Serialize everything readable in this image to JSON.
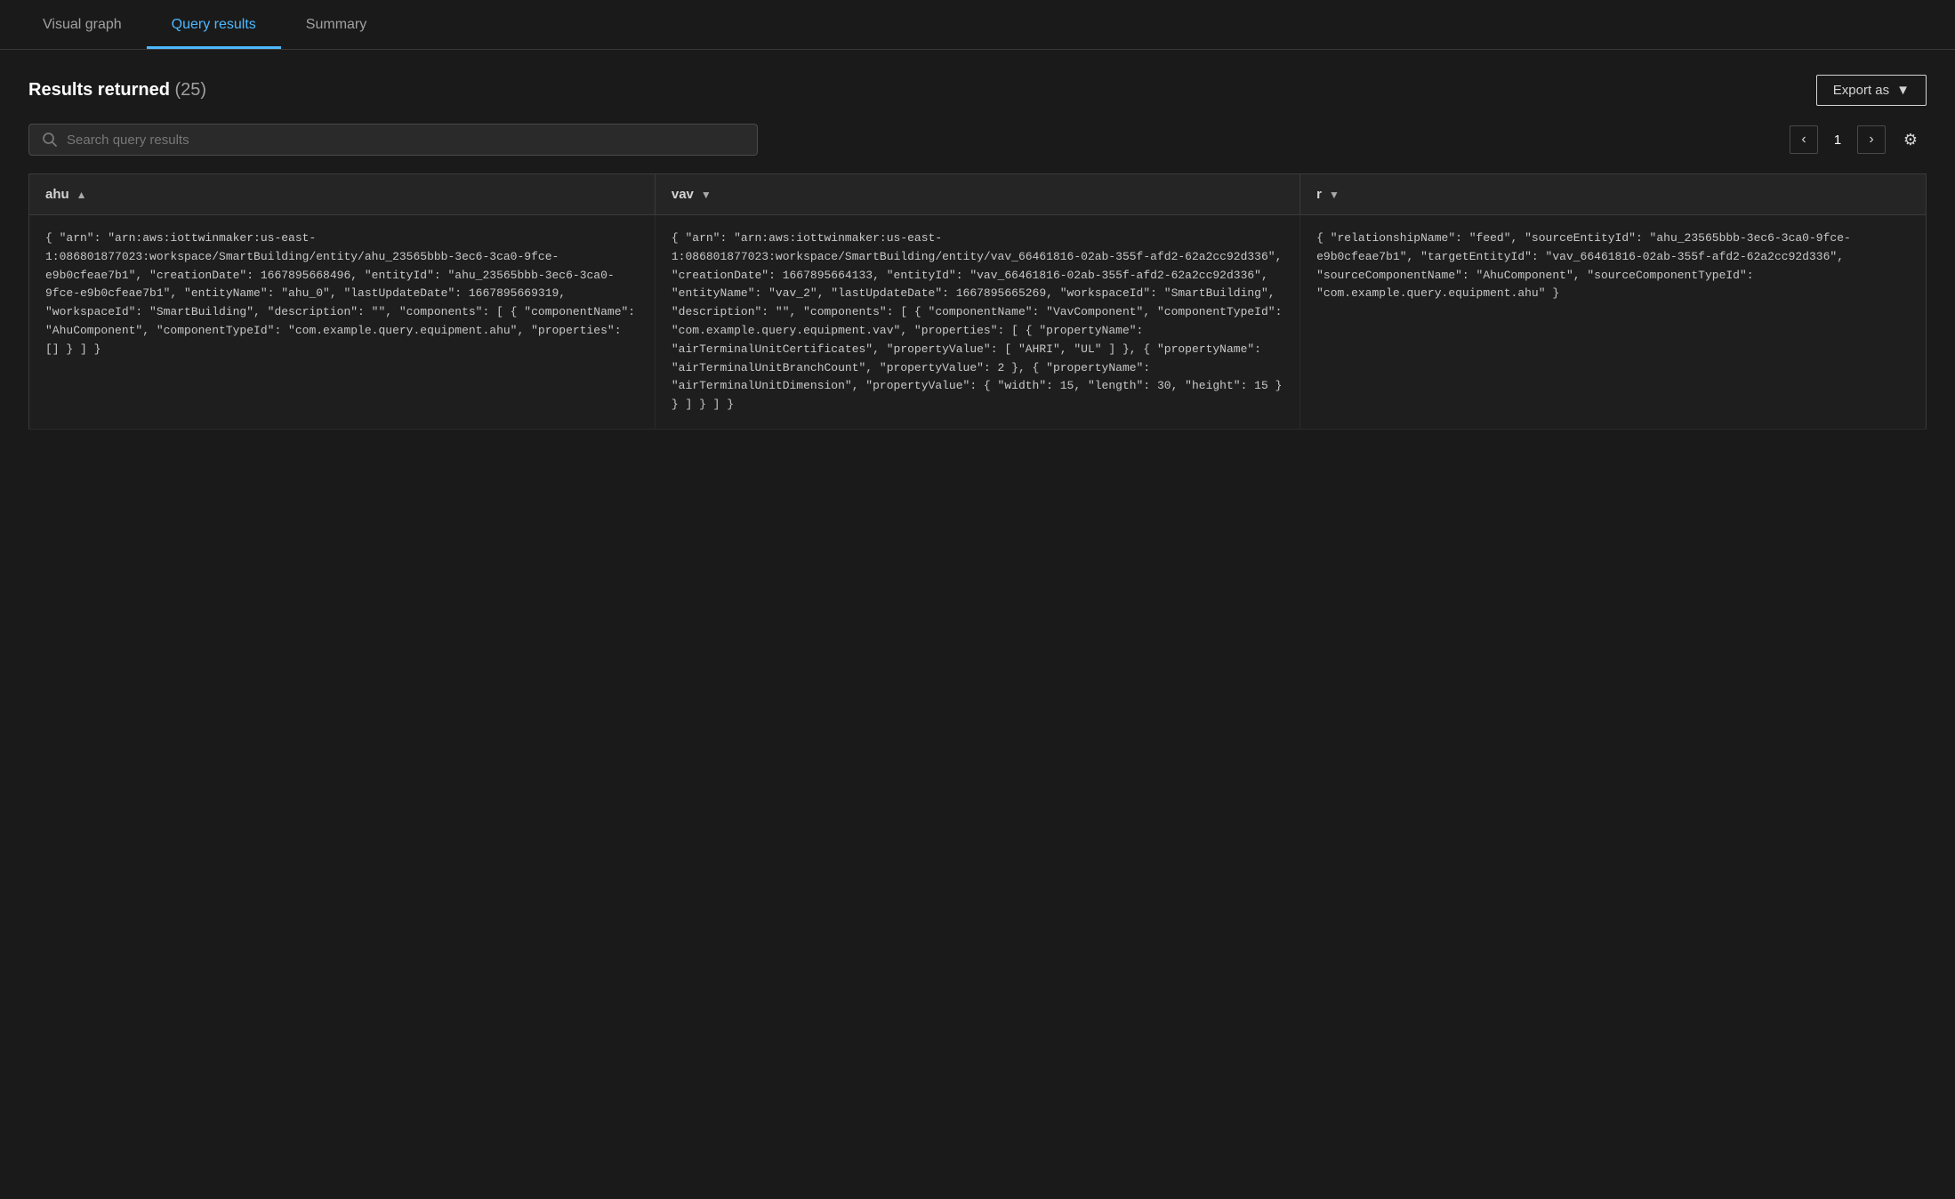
{
  "tabs": [
    {
      "id": "visual-graph",
      "label": "Visual graph",
      "active": false
    },
    {
      "id": "query-results",
      "label": "Query results",
      "active": true
    },
    {
      "id": "summary",
      "label": "Summary",
      "active": false
    }
  ],
  "results_section": {
    "title": "Results returned",
    "count": "(25)",
    "export_label": "Export as"
  },
  "search": {
    "placeholder": "Search query results"
  },
  "pagination": {
    "current_page": "1"
  },
  "table": {
    "columns": [
      {
        "id": "ahu",
        "label": "ahu",
        "sort": "asc"
      },
      {
        "id": "vav",
        "label": "vav",
        "sort": "desc"
      },
      {
        "id": "r",
        "label": "r",
        "sort": "desc"
      }
    ],
    "rows": [
      {
        "ahu": "{ \"arn\": \"arn:aws:iottwinmaker:us-east-1:086801877023:workspace/SmartBuilding/entity/ahu_23565bbb-3ec6-3ca0-9fce-e9b0cfeae7b1\", \"creationDate\": 1667895668496, \"entityId\": \"ahu_23565bbb-3ec6-3ca0-9fce-e9b0cfeae7b1\", \"entityName\": \"ahu_0\", \"lastUpdateDate\": 1667895669319, \"workspaceId\": \"SmartBuilding\", \"description\": \"\", \"components\": [ { \"componentName\": \"AhuComponent\", \"componentTypeId\": \"com.example.query.equipment.ahu\", \"properties\": [] } ] }",
        "vav": "{ \"arn\": \"arn:aws:iottwinmaker:us-east-1:086801877023:workspace/SmartBuilding/entity/vav_66461816-02ab-355f-afd2-62a2cc92d336\", \"creationDate\": 1667895664133, \"entityId\": \"vav_66461816-02ab-355f-afd2-62a2cc92d336\", \"entityName\": \"vav_2\", \"lastUpdateDate\": 1667895665269, \"workspaceId\": \"SmartBuilding\", \"description\": \"\", \"components\": [ { \"componentName\": \"VavComponent\", \"componentTypeId\": \"com.example.query.equipment.vav\", \"properties\": [ { \"propertyName\": \"airTerminalUnitCertificates\", \"propertyValue\": [ \"AHRI\", \"UL\" ] }, { \"propertyName\": \"airTerminalUnitBranchCount\", \"propertyValue\": 2 }, { \"propertyName\": \"airTerminalUnitDimension\", \"propertyValue\": { \"width\": 15, \"length\": 30, \"height\": 15 } } ] } ] }",
        "r": "{ \"relationshipName\": \"feed\", \"sourceEntityId\": \"ahu_23565bbb-3ec6-3ca0-9fce-e9b0cfeae7b1\", \"targetEntityId\": \"vav_66461816-02ab-355f-afd2-62a2cc92d336\", \"sourceComponentName\": \"AhuComponent\", \"sourceComponentTypeId\": \"com.example.query.equipment.ahu\" }"
      }
    ]
  }
}
